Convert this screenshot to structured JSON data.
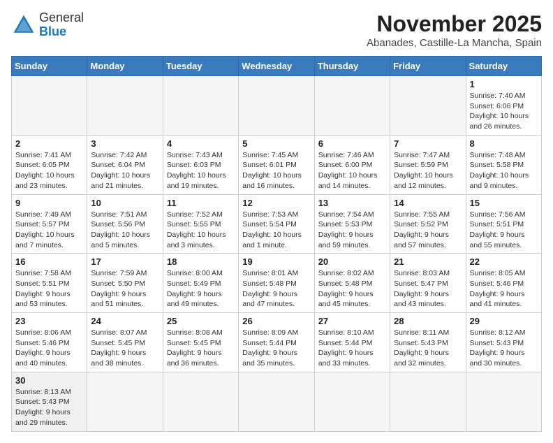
{
  "logo": {
    "general": "General",
    "blue": "Blue"
  },
  "header": {
    "month_year": "November 2025",
    "location": "Abanades, Castille-La Mancha, Spain"
  },
  "weekdays": [
    "Sunday",
    "Monday",
    "Tuesday",
    "Wednesday",
    "Thursday",
    "Friday",
    "Saturday"
  ],
  "weeks": [
    [
      {
        "day": "",
        "info": ""
      },
      {
        "day": "",
        "info": ""
      },
      {
        "day": "",
        "info": ""
      },
      {
        "day": "",
        "info": ""
      },
      {
        "day": "",
        "info": ""
      },
      {
        "day": "",
        "info": ""
      },
      {
        "day": "1",
        "info": "Sunrise: 7:40 AM\nSunset: 6:06 PM\nDaylight: 10 hours and 26 minutes."
      }
    ],
    [
      {
        "day": "2",
        "info": "Sunrise: 7:41 AM\nSunset: 6:05 PM\nDaylight: 10 hours and 23 minutes."
      },
      {
        "day": "3",
        "info": "Sunrise: 7:42 AM\nSunset: 6:04 PM\nDaylight: 10 hours and 21 minutes."
      },
      {
        "day": "4",
        "info": "Sunrise: 7:43 AM\nSunset: 6:03 PM\nDaylight: 10 hours and 19 minutes."
      },
      {
        "day": "5",
        "info": "Sunrise: 7:45 AM\nSunset: 6:01 PM\nDaylight: 10 hours and 16 minutes."
      },
      {
        "day": "6",
        "info": "Sunrise: 7:46 AM\nSunset: 6:00 PM\nDaylight: 10 hours and 14 minutes."
      },
      {
        "day": "7",
        "info": "Sunrise: 7:47 AM\nSunset: 5:59 PM\nDaylight: 10 hours and 12 minutes."
      },
      {
        "day": "8",
        "info": "Sunrise: 7:48 AM\nSunset: 5:58 PM\nDaylight: 10 hours and 9 minutes."
      }
    ],
    [
      {
        "day": "9",
        "info": "Sunrise: 7:49 AM\nSunset: 5:57 PM\nDaylight: 10 hours and 7 minutes."
      },
      {
        "day": "10",
        "info": "Sunrise: 7:51 AM\nSunset: 5:56 PM\nDaylight: 10 hours and 5 minutes."
      },
      {
        "day": "11",
        "info": "Sunrise: 7:52 AM\nSunset: 5:55 PM\nDaylight: 10 hours and 3 minutes."
      },
      {
        "day": "12",
        "info": "Sunrise: 7:53 AM\nSunset: 5:54 PM\nDaylight: 10 hours and 1 minute."
      },
      {
        "day": "13",
        "info": "Sunrise: 7:54 AM\nSunset: 5:53 PM\nDaylight: 9 hours and 59 minutes."
      },
      {
        "day": "14",
        "info": "Sunrise: 7:55 AM\nSunset: 5:52 PM\nDaylight: 9 hours and 57 minutes."
      },
      {
        "day": "15",
        "info": "Sunrise: 7:56 AM\nSunset: 5:51 PM\nDaylight: 9 hours and 55 minutes."
      }
    ],
    [
      {
        "day": "16",
        "info": "Sunrise: 7:58 AM\nSunset: 5:51 PM\nDaylight: 9 hours and 53 minutes."
      },
      {
        "day": "17",
        "info": "Sunrise: 7:59 AM\nSunset: 5:50 PM\nDaylight: 9 hours and 51 minutes."
      },
      {
        "day": "18",
        "info": "Sunrise: 8:00 AM\nSunset: 5:49 PM\nDaylight: 9 hours and 49 minutes."
      },
      {
        "day": "19",
        "info": "Sunrise: 8:01 AM\nSunset: 5:48 PM\nDaylight: 9 hours and 47 minutes."
      },
      {
        "day": "20",
        "info": "Sunrise: 8:02 AM\nSunset: 5:48 PM\nDaylight: 9 hours and 45 minutes."
      },
      {
        "day": "21",
        "info": "Sunrise: 8:03 AM\nSunset: 5:47 PM\nDaylight: 9 hours and 43 minutes."
      },
      {
        "day": "22",
        "info": "Sunrise: 8:05 AM\nSunset: 5:46 PM\nDaylight: 9 hours and 41 minutes."
      }
    ],
    [
      {
        "day": "23",
        "info": "Sunrise: 8:06 AM\nSunset: 5:46 PM\nDaylight: 9 hours and 40 minutes."
      },
      {
        "day": "24",
        "info": "Sunrise: 8:07 AM\nSunset: 5:45 PM\nDaylight: 9 hours and 38 minutes."
      },
      {
        "day": "25",
        "info": "Sunrise: 8:08 AM\nSunset: 5:45 PM\nDaylight: 9 hours and 36 minutes."
      },
      {
        "day": "26",
        "info": "Sunrise: 8:09 AM\nSunset: 5:44 PM\nDaylight: 9 hours and 35 minutes."
      },
      {
        "day": "27",
        "info": "Sunrise: 8:10 AM\nSunset: 5:44 PM\nDaylight: 9 hours and 33 minutes."
      },
      {
        "day": "28",
        "info": "Sunrise: 8:11 AM\nSunset: 5:43 PM\nDaylight: 9 hours and 32 minutes."
      },
      {
        "day": "29",
        "info": "Sunrise: 8:12 AM\nSunset: 5:43 PM\nDaylight: 9 hours and 30 minutes."
      }
    ],
    [
      {
        "day": "30",
        "info": "Sunrise: 8:13 AM\nSunset: 5:43 PM\nDaylight: 9 hours and 29 minutes."
      },
      {
        "day": "",
        "info": ""
      },
      {
        "day": "",
        "info": ""
      },
      {
        "day": "",
        "info": ""
      },
      {
        "day": "",
        "info": ""
      },
      {
        "day": "",
        "info": ""
      },
      {
        "day": "",
        "info": ""
      }
    ]
  ]
}
